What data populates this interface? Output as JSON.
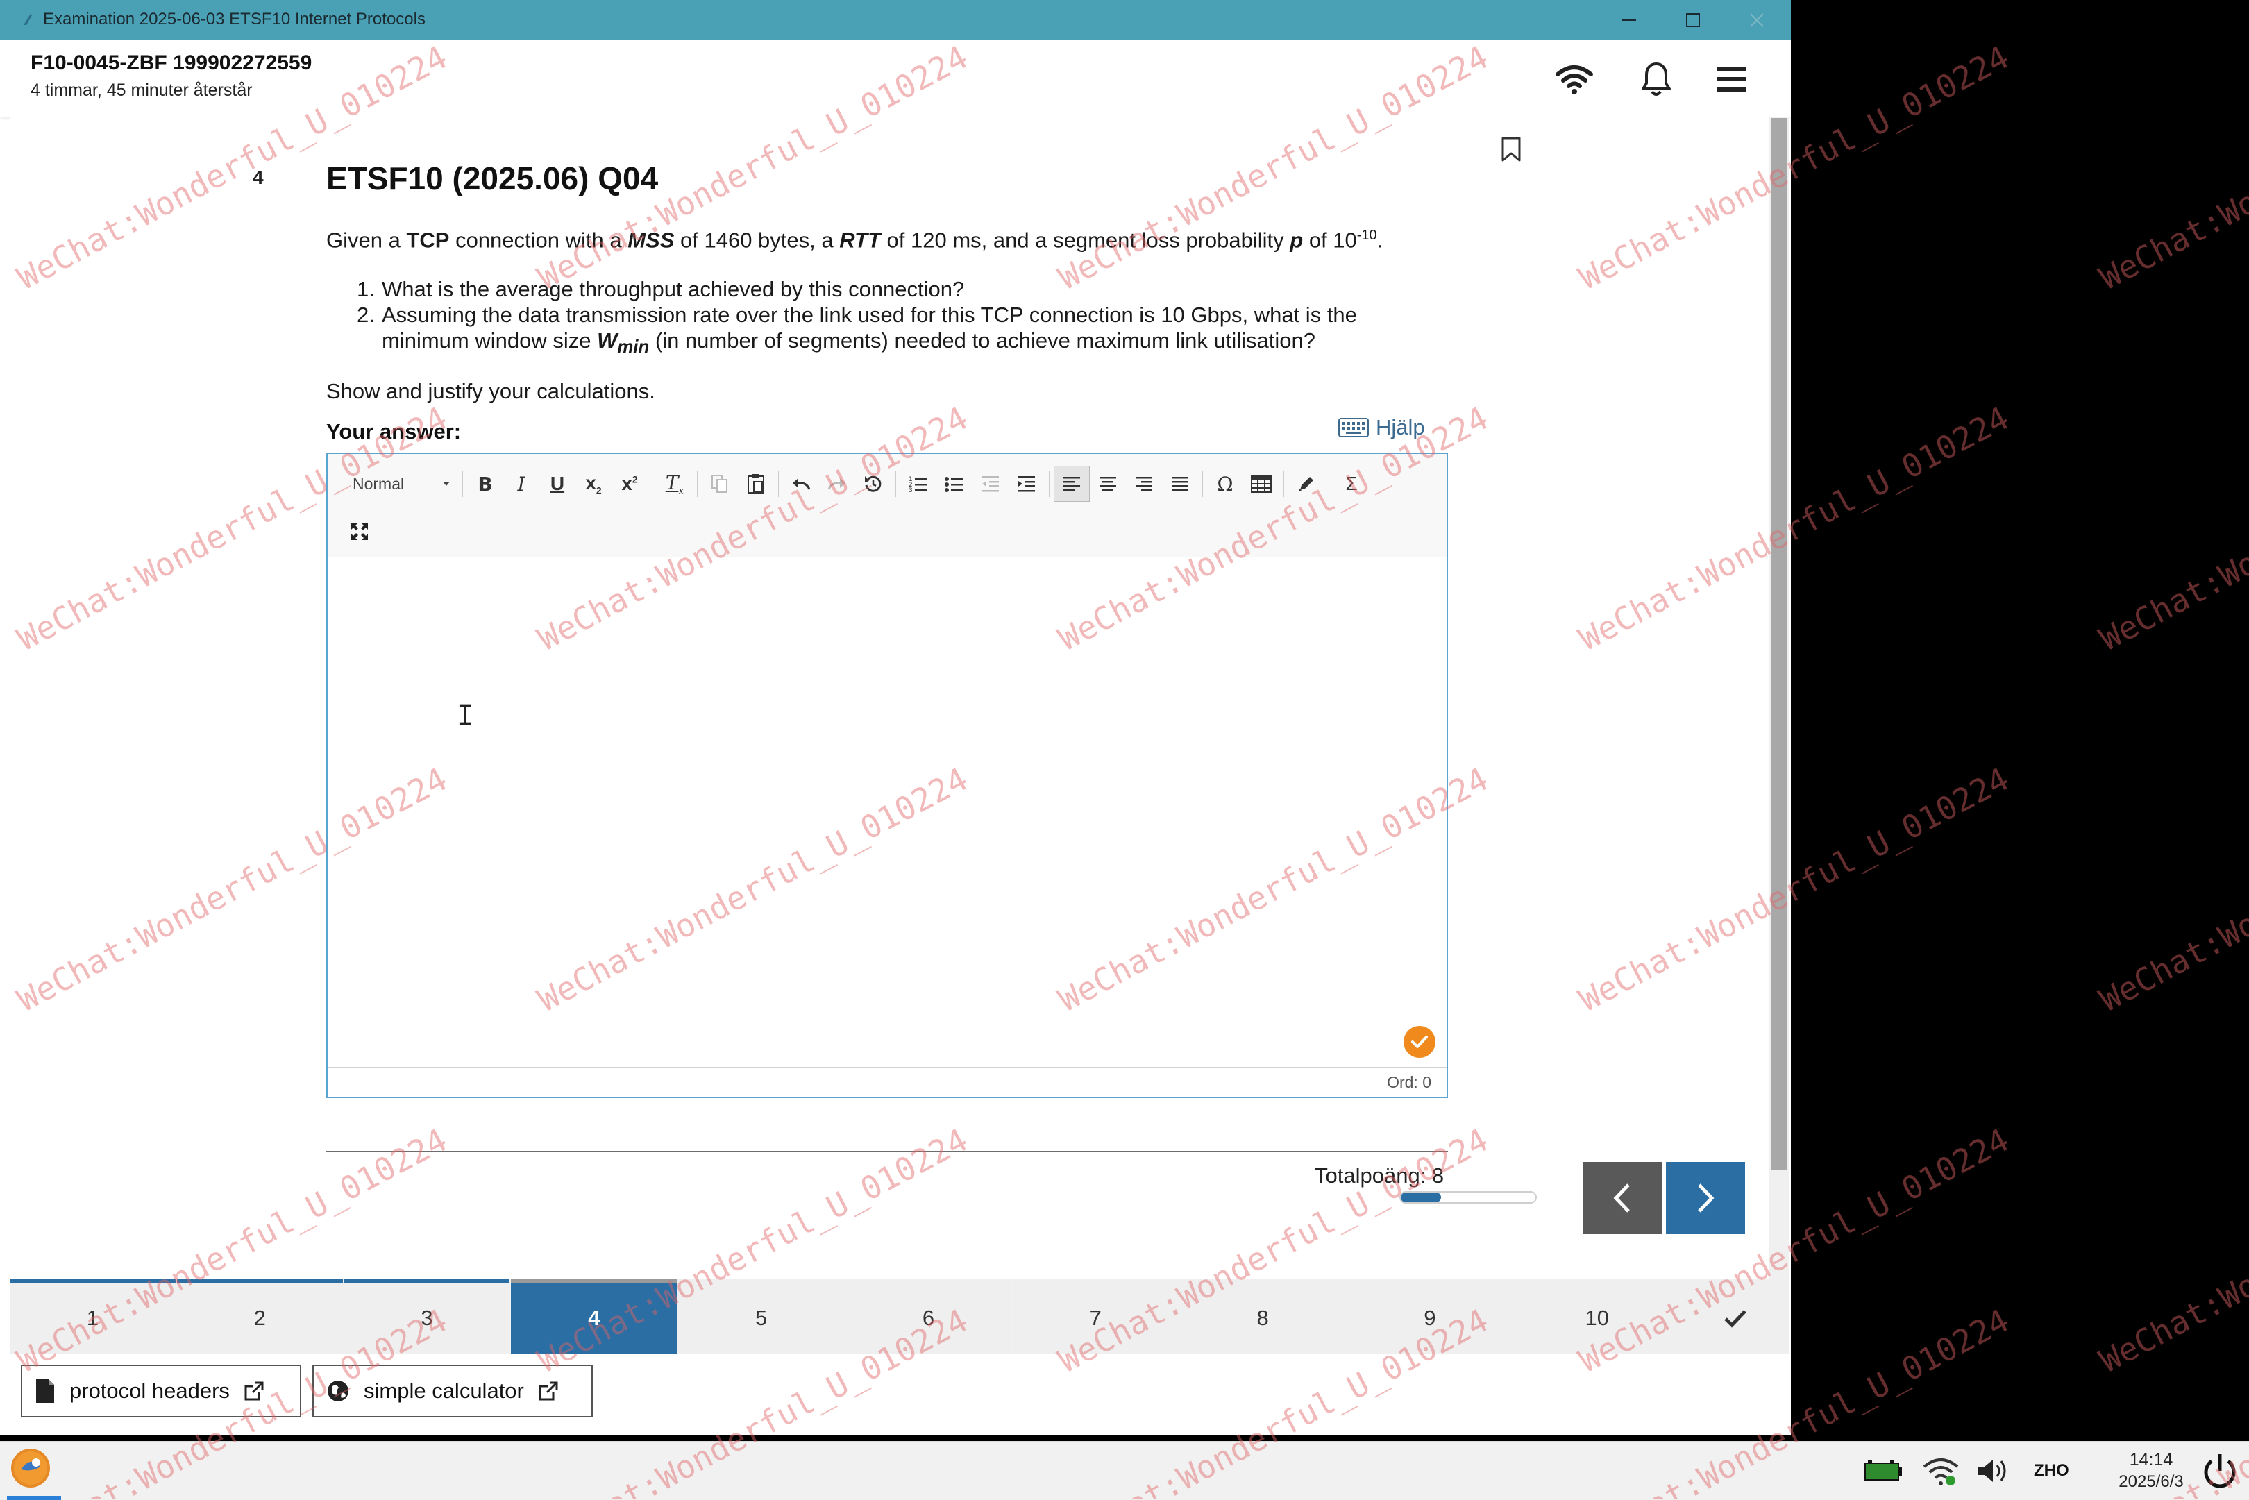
{
  "window": {
    "title": "Examination 2025-06-03 ETSF10 Internet Protocols",
    "controls": [
      "minimize-icon",
      "maximize-icon",
      "close-icon"
    ]
  },
  "header": {
    "exam_id": "F10-0045-ZBF 199902272559",
    "time_left": "4 timmar, 45 minuter återstår",
    "icons": [
      "wifi-icon",
      "bell-icon",
      "hamburger-menu-icon"
    ]
  },
  "question": {
    "number": "4",
    "title": "ETSF10 (2025.06) Q04",
    "intro": {
      "p1": "Given a ",
      "tcp": "TCP",
      "p2": " connection with a ",
      "mss": "MSS",
      "p3": " of 1460 bytes, a ",
      "rtt": "RTT",
      "p4": " of 120 ms, and a segment loss probability ",
      "p": "p",
      "p5": " of 10",
      "exp": "-10",
      "p6": "."
    },
    "items": [
      {
        "n": "1.",
        "text": "What is the average throughput achieved by this connection?"
      },
      {
        "n": "2.",
        "line1": "Assuming the data transmission rate over the link used for this TCP connection is 10 Gbps, what is the",
        "line2a": "minimum window size ",
        "w": "W",
        "wsub": "min",
        "line2b": " (in number of segments) needed to achieve maximum link utilisation?"
      }
    ],
    "justify": "Show and justify your calculations.",
    "your_answer": "Your answer:",
    "help": "Hjälp"
  },
  "editor": {
    "format": "Normal",
    "word_count": "Ord: 0",
    "toolbar_icons": [
      "bold-icon",
      "italic-icon",
      "underline-icon",
      "subscript-icon",
      "superscript-icon",
      "remove-format-icon",
      "copy-icon",
      "paste-icon",
      "undo-icon",
      "redo-icon",
      "restore-icon",
      "numbered-list-icon",
      "bulleted-list-icon",
      "outdent-icon",
      "indent-icon",
      "align-left-icon",
      "align-center-icon",
      "align-right-icon",
      "justify-icon",
      "special-char-icon",
      "table-icon",
      "draw-icon",
      "sigma-icon",
      "maximize-icon"
    ]
  },
  "score": {
    "label": "Totalpoäng: 8",
    "progress_fraction": 0.3
  },
  "tabs": [
    "1",
    "2",
    "3",
    "4",
    "5",
    "6",
    "7",
    "8",
    "9",
    "10"
  ],
  "tabs_current": "4",
  "resources": [
    {
      "label": "protocol headers",
      "icon": "document-icon"
    },
    {
      "label": "simple calculator",
      "icon": "globe-icon"
    }
  ],
  "taskbar": {
    "language": "ZHO",
    "time": "14:14",
    "date": "2025/6/3"
  },
  "watermark": "WeChat:Wonderful_U_010224",
  "colors": {
    "titlebar": "#4aa0b4",
    "accent": "#2a6ea4",
    "nav_prev": "#595959",
    "check_badge": "#f08a1c",
    "watermark": "#e06464"
  }
}
